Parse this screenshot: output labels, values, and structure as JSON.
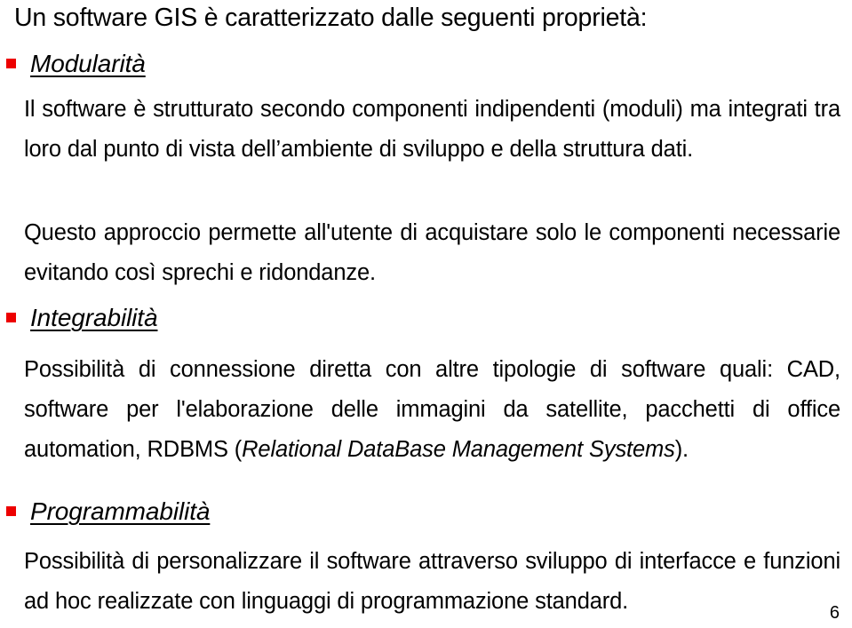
{
  "slide": {
    "title": "Un software GIS è caratterizzato dalle seguenti proprietà:",
    "page_number": "6",
    "bullet_color": "#ED0000",
    "text_color": "#000000",
    "background_color": "#FFFFFF",
    "sections": [
      {
        "heading": "Modularità",
        "paragraphs": [
          "Il software è strutturato secondo componenti indipendenti (moduli) ma integrati tra loro dal punto di vista dell’ambiente di sviluppo e della struttura dati.",
          "Questo approccio permette all'utente di acquistare solo le componenti necessarie evitando così sprechi e ridondanze."
        ]
      },
      {
        "heading": "Integrabilità",
        "paragraphs": [
          "Possibilità di connessione diretta con altre tipologie di software quali: CAD, software per l'elaborazione delle immagini da satellite, pacchetti di office automation, RDBMS (Relational DataBase Management Systems)."
        ],
        "italic_fragment": "Relational DataBase Management Systems"
      },
      {
        "heading": "Programmabilità",
        "paragraphs": [
          "Possibilità di personalizzare il software attraverso sviluppo di interfacce e funzioni ad hoc realizzate con linguaggi di programmazione standard."
        ]
      }
    ]
  }
}
